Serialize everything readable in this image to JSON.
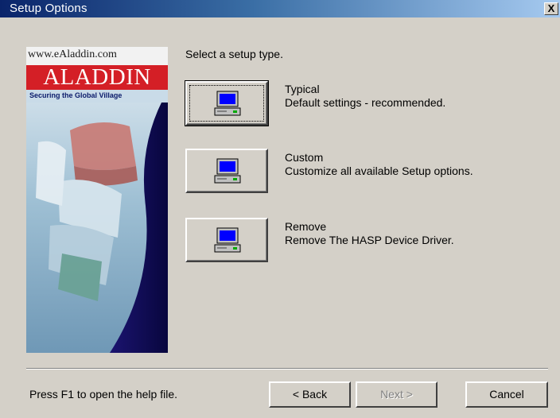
{
  "window": {
    "title": "Setup Options",
    "close_label": "X"
  },
  "banner": {
    "url": "www.eAladdin.com",
    "brand": "ALADDIN",
    "tagline": "Securing the Global Village"
  },
  "main": {
    "prompt": "Select a setup type.",
    "options": [
      {
        "title": "Typical",
        "description": "Default settings - recommended.",
        "focused": true
      },
      {
        "title": "Custom",
        "description": "Customize all available Setup options.",
        "focused": false
      },
      {
        "title": "Remove",
        "description": "Remove The HASP Device Driver.",
        "focused": false
      }
    ]
  },
  "footer": {
    "help_text": "Press F1 to open the help file.",
    "back_label": "< Back",
    "next_label": "Next >",
    "cancel_label": "Cancel",
    "next_enabled": false
  },
  "colors": {
    "dialog_bg": "#d4d0c8",
    "title_bar_start": "#0a246a",
    "title_bar_end": "#a6caf0",
    "brand_red": "#d41f26"
  }
}
